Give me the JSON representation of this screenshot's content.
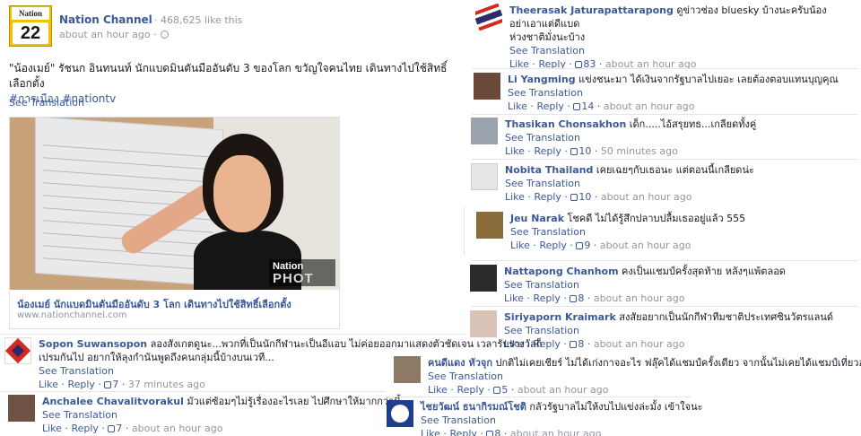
{
  "post": {
    "logo_top": "Nation",
    "logo_num": "22",
    "page_name": "Nation Channel",
    "likes": "· 468,625 like this",
    "time": "about an hour ago ·",
    "text_line1": "\"น้องเมย์\" รัชนก อินทนนท์ นักแบดมินตันมืออันดับ 3 ของโลก ขวัญใจคนไทย เดินทางไปใช้สิทธิ์เลือกตั้ง",
    "tags": "#การเมือง #nationtv",
    "see_translation": "See Translation",
    "card_title": "น้องเมย์ นักแบดมินตันมืออันดับ 3 โลก เดินทางไปใช้สิทธิ์เลือกตั้ง",
    "card_url": "www.nationchannel.com",
    "watermark_top": "Nation",
    "watermark_bottom": "PHOT"
  },
  "comments": [
    {
      "name": "Theerasak Jaturapattarapong",
      "text": "ดูข่าวช่อง bluesky บ้างนะครับน้อง",
      "text2": "อย่าเอาแต่ดีแบด",
      "text3": "ห่วงชาติมั่งนะบ้าง",
      "see": "See Translation",
      "like": "Like",
      "reply": "Reply",
      "count": "83",
      "time": "about an hour ago"
    },
    {
      "name": "Li Yangming",
      "text": "แข่งชนะมา ได้เงินจากรัฐบาลไปเยอะ เลยต้องตอบแทนบุญคุณ",
      "see": "See Translation",
      "like": "Like",
      "reply": "Reply",
      "count": "14",
      "time": "about an hour ago"
    },
    {
      "name": "Thasikan Chonsakhon",
      "text": "เด็ก.....ไอ้สรุยทธ...เกลียดทั้งคู่",
      "see": "See Translation",
      "like": "Like",
      "reply": "Reply",
      "count": "10",
      "time": "50 minutes ago"
    },
    {
      "name": "Nobita Thailand",
      "text": "เคยเฉยๆกับเธอนะ แต่ตอนนี้เกลียดน่ะ",
      "see": "See Translation",
      "like": "Like",
      "reply": "Reply",
      "count": "10",
      "time": "about an hour ago"
    },
    {
      "name": "Jeu Narak",
      "text": "โชคดี ไม่ได้รู้สึกปลาบปลื้มเธออยู่แล้ว 555",
      "see": "See Translation",
      "like": "Like",
      "reply": "Reply",
      "count": "9",
      "time": "about an hour ago"
    },
    {
      "name": "Nattapong Chanhom",
      "text": "คงเป็นแชมป์ครั้งสุดท้าย หลังๆแพ้ตลอด",
      "see": "See Translation",
      "like": "Like",
      "reply": "Reply",
      "count": "8",
      "time": "about an hour ago"
    },
    {
      "name": "Siriyaporn Kraimark",
      "text": "สงสัยอยากเป็นนักกีฬาทีมชาติประเทศซินวัตรแลนด์",
      "see": "See Translation",
      "like": "Like",
      "reply": "Reply",
      "count": "8",
      "time": "about an hour ago"
    },
    {
      "name": "Sopon Suwansopon",
      "text": "ลองสังเกตดูนะ...พวกที่เป็นนักกีฬานะเป็นอีแอบ ไม่ค่อยออกมาแสดงตัวชัดเจน เวลารับรางวัลก็",
      "text2": "เปรมกันไป อยากให้ลุงกำนันพูดถึงคนกลุ่มนี้บ้างบนเวที...",
      "see": "See Translation",
      "like": "Like",
      "reply": "Reply",
      "count": "7",
      "time": "37 minutes ago"
    },
    {
      "name": "คนดีแดง หัวจุก",
      "text": "ปกติไม่เคยเชียร์ ไม่ได้เก่งกาจอะไร ฟลุ๊คได้แชมป์ครั้งเดียว จากนั้นไม่เคยได้แชมป์เที่ยวอะไรเลย",
      "see": "See Translation",
      "like": "Like",
      "reply": "Reply",
      "count": "5",
      "time": "about an hour ago"
    },
    {
      "name": "Anchalee Chavalitvorakul",
      "text": "มัวแต่ซ้อมๆไม่รู้เรื่องอะไรเลย ไปศึกษาให้มากกว่านี้",
      "see": "See Translation",
      "like": "Like",
      "reply": "Reply",
      "count": "7",
      "time": "about an hour ago"
    },
    {
      "name": "ไชยวัฒน์ ธนากิรมณ์โชติ",
      "text": "กลัวรัฐบาลไม่ให้งบไปแข่งล่ะมั้ง เข้าใจนะ",
      "see": "See Translation",
      "like": "Like",
      "reply": "Reply",
      "count": "8",
      "time": "about an hour ago"
    }
  ]
}
